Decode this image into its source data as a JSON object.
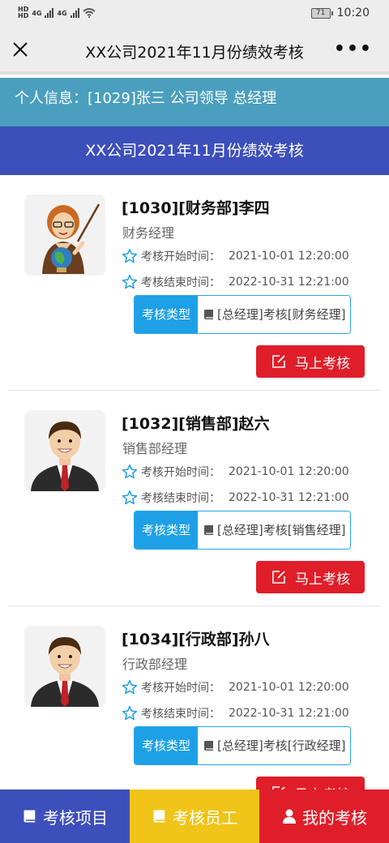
{
  "status_bar": {
    "sim1": "HD",
    "sim2": "HD",
    "net1": "4G",
    "net2": "4G",
    "battery": "71",
    "time": "10:20"
  },
  "titlebar": {
    "title": "XX公司2021年11月份绩效考核",
    "more": "•••"
  },
  "info_bar": {
    "text": "个人信息：[1029]张三 公司领导 总经理"
  },
  "header": {
    "title": "XX公司2021年11月份绩效考核"
  },
  "cards": [
    {
      "name": "[1030][财务部]李四",
      "position": "财务经理",
      "start_label": "考核开始时间：",
      "start_value": "2021-10-01 12:20:00",
      "end_label": "考核结束时间：",
      "end_value": "2022-10-31 12:21:00",
      "type_label": "考核类型",
      "type_value": "[总经理]考核[财务经理]",
      "button": "马上考核",
      "avatar": "teacher-woman"
    },
    {
      "name": "[1032][销售部]赵六",
      "position": "销售部经理",
      "start_label": "考核开始时间：",
      "start_value": "2021-10-01 12:20:00",
      "end_label": "考核结束时间：",
      "end_value": "2022-10-31 12:21:00",
      "type_label": "考核类型",
      "type_value": "[总经理]考核[销售经理]",
      "button": "马上考核",
      "avatar": "businessman"
    },
    {
      "name": "[1034][行政部]孙八",
      "position": "行政部经理",
      "start_label": "考核开始时间：",
      "start_value": "2021-10-01 12:20:00",
      "end_label": "考核结束时间：",
      "end_value": "2022-10-31 12:21:00",
      "type_label": "考核类型",
      "type_value": "[总经理]考核[行政经理]",
      "button": "马上考核",
      "avatar": "businessman"
    }
  ],
  "bottom_nav": {
    "items": [
      {
        "label": "考核项目",
        "icon": "book-icon",
        "color": "#3d4fbb"
      },
      {
        "label": "考核员工",
        "icon": "book-icon",
        "color": "#f0c419"
      },
      {
        "label": "我的考核",
        "icon": "user-icon",
        "color": "#e01e2a"
      }
    ]
  },
  "colors": {
    "info_bar": "#4a9fbe",
    "header": "#3d4fbb",
    "button": "#e01e2a",
    "type_label": "#1ea0e6"
  }
}
